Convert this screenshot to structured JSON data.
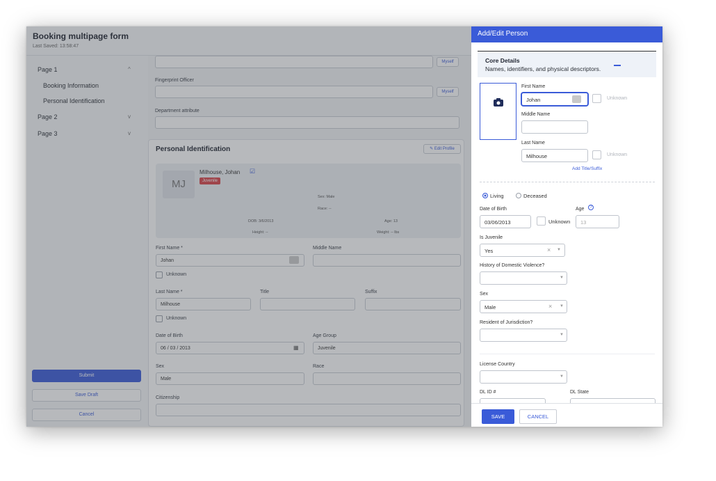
{
  "app": {
    "title": "Booking multipage form",
    "last_saved": "Last Saved: 13:58:47"
  },
  "nav": {
    "pages": [
      {
        "label": "Page 1",
        "chevron": "^"
      },
      {
        "label": "Page 2",
        "chevron": "v"
      },
      {
        "label": "Page 3",
        "chevron": "v"
      }
    ],
    "subitems": [
      "Booking Information",
      "Personal Identification"
    ],
    "submit": "Submit",
    "save_draft": "Save Draft",
    "cancel": "Cancel"
  },
  "main": {
    "myself": "Myself",
    "fingerprint_officer": "Fingerprint Officer",
    "department_attribute": "Department attribute",
    "personal_identification": "Personal Identification",
    "edit_profile": "Edit Profile",
    "summary": {
      "initials": "MJ",
      "name": "Milhouse, Johan",
      "tag": "Juvenile",
      "sex": "Sex: Male",
      "race": "Race: --",
      "dob": "DOB: 3/6/2013",
      "age": "Age: 13",
      "height": "Height: --",
      "weight": "Weight: -- lbs"
    },
    "first_name_label": "First Name *",
    "first_name_value": "Johan",
    "middle_name_label": "Middle Name",
    "unknown": "Unknown",
    "last_name_label": "Last Name *",
    "last_name_value": "Milhouse",
    "title_label": "Title",
    "suffix_label": "Suffix",
    "dob_label": "Date of Birth",
    "dob_value": "06 / 03 / 2013",
    "age_group_label": "Age Group",
    "age_group_value": "Juvenile",
    "sex_label": "Sex",
    "sex_value": "Male",
    "race_label": "Race",
    "citizenship_label": "Citizenship"
  },
  "panel": {
    "title": "Add/Edit Person",
    "section_title": "Core Details",
    "section_subtitle": "Names, identifiers, and physical descriptors.",
    "first_name_label": "First Name",
    "first_name_value": "Johan",
    "unknown": "Unknown",
    "middle_name_label": "Middle Name",
    "last_name_label": "Last Name",
    "last_name_value": "Milhouse",
    "add_title_suffix": "Add Title/Suffix",
    "living": "Living",
    "deceased": "Deceased",
    "dob_label": "Date of Birth",
    "dob_value": "03/06/2013",
    "age_label": "Age",
    "age_value": "13",
    "is_juvenile_label": "Is Juvenile",
    "is_juvenile_value": "Yes",
    "dv_history_label": "History of Domestic Violence?",
    "sex_label": "Sex",
    "sex_value": "Male",
    "resident_label": "Resident of Jurisdiction?",
    "license_country_label": "License Country",
    "dl_id_label": "DL ID #",
    "dl_state_label": "DL State",
    "save": "SAVE",
    "cancel": "CANCEL"
  },
  "colors": {
    "accent": "#3a5bd8",
    "juvenile_tag": "#d9444a",
    "overlay": "rgba(65,70,80,0.38)"
  },
  "icons": [
    "camera-icon",
    "edit-icon",
    "pencil-icon",
    "calendar-icon",
    "chevron-down-icon",
    "clear-icon",
    "help-icon",
    "contact-card-icon",
    "collapse-icon"
  ]
}
